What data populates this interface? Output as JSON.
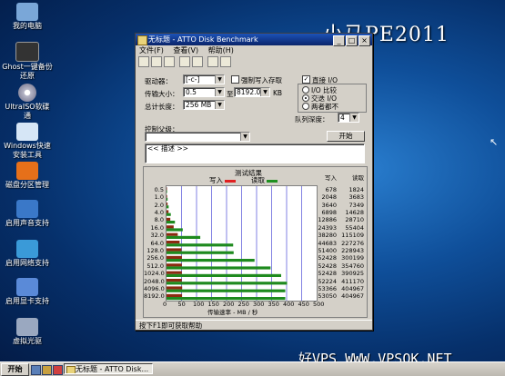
{
  "desktop": {
    "icons": [
      {
        "label": "我的电脑",
        "icon": "computer-icon",
        "color": "#7aa7d8"
      },
      {
        "label": "Ghost一键备份还原",
        "icon": "ghost-icon",
        "color": "#333333"
      },
      {
        "label": "UltraISO软碟通",
        "icon": "disc-icon",
        "color": "#b8b8c8"
      },
      {
        "label": "Windows快速安装工具",
        "icon": "windows-install-icon",
        "color": "#d6e6f6"
      },
      {
        "label": "磁盘分区管理",
        "icon": "partition-icon",
        "color": "#e6701a"
      },
      {
        "label": "启用声音支持",
        "icon": "sound-icon",
        "color": "#3a78c8"
      },
      {
        "label": "启用网络支持",
        "icon": "network-icon",
        "color": "#3a9ad8"
      },
      {
        "label": "启用显卡支持",
        "icon": "display-icon",
        "color": "#5a8ad8"
      },
      {
        "label": "虚拟光驱",
        "icon": "virtual-drive-icon",
        "color": "#9aa8c0"
      }
    ],
    "brand": "小马PE2011",
    "watermark": "好VPS WWW.VPSOK.NET"
  },
  "window": {
    "title": "无标题 - ATTO Disk Benchmark",
    "menu": [
      "文件(F)",
      "查看(V)",
      "帮助(H)"
    ],
    "toolbar_icons": [
      "new-icon",
      "open-icon",
      "save-icon",
      "print-icon",
      "preview-icon",
      "help-icon",
      "about-icon"
    ],
    "drive_label": "驱动器：",
    "drive_value": "[-c-]",
    "force_write_label": "强制写入存取",
    "direct_io_label": "直接 I/O",
    "transfer_label": "传输大小：",
    "transfer_from": "0.5",
    "transfer_to_label": "至",
    "transfer_to": "8192.0",
    "transfer_unit": "KB",
    "total_label": "总计长度：",
    "total_value": "256 MB",
    "io_compare": "I/O 比较",
    "overlapped_io": "交迭 I/O",
    "neither": "两者都不",
    "queue_label": "队列深度：",
    "queue_value": "4",
    "control_label": "控制父级：",
    "start_button": "开始",
    "description": "<< 描述 >>",
    "status": "按下F1即可获取帮助"
  },
  "chart_data": {
    "type": "bar",
    "title": "测试结果",
    "legend": [
      {
        "name": "写入",
        "color": "#e02020"
      },
      {
        "name": "读取",
        "color": "#209020"
      }
    ],
    "xlabel": "传输速率 - MB / 秒",
    "xlim": [
      0,
      500
    ],
    "xticks": [
      "0",
      "50",
      "100",
      "150",
      "200",
      "250",
      "300",
      "350",
      "400",
      "450",
      "500"
    ],
    "categories": [
      "0.5",
      "1.0",
      "2.0",
      "4.0",
      "8.0",
      "16.0",
      "32.0",
      "64.0",
      "128.0",
      "256.0",
      "512.0",
      "1024.0",
      "2048.0",
      "4096.0",
      "8192.0"
    ],
    "series": [
      {
        "name": "写入",
        "values_kb": [
          678,
          2048,
          3640,
          6898,
          12886,
          24393,
          38280,
          44683,
          51400,
          52428,
          52428,
          52428,
          52224,
          53366,
          53050
        ]
      },
      {
        "name": "读取",
        "values_kb": [
          1824,
          3683,
          7349,
          14628,
          28710,
          55404,
          115109,
          227276,
          228943,
          300199,
          354760,
          390925,
          411170,
          404967,
          404967
        ]
      }
    ],
    "column_headers": [
      "写入",
      "读取"
    ]
  },
  "taskbar": {
    "start": "开始",
    "task": "无标题 - ATTO Disk..."
  }
}
